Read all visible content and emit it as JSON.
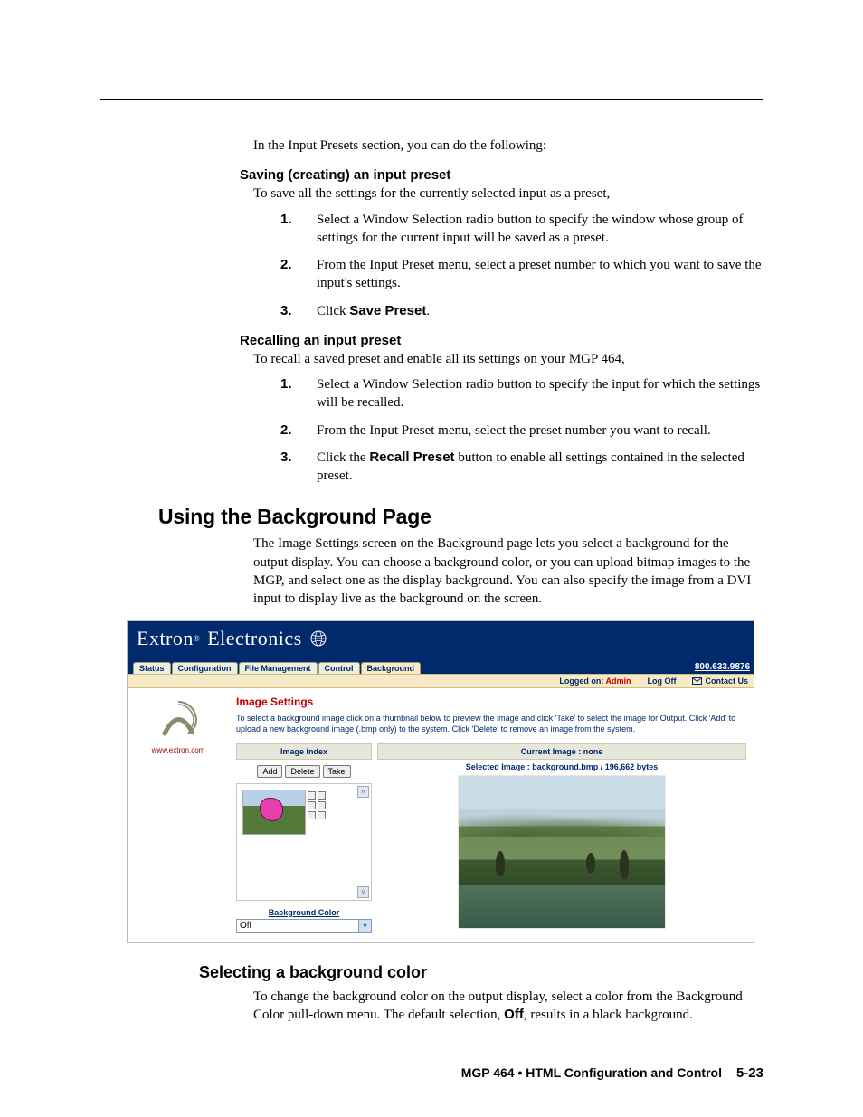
{
  "intro": "In the Input Presets section, you can do the following:",
  "saving": {
    "heading": "Saving (creating) an input preset",
    "lead": "To save all the settings for the currently selected input as a preset,",
    "n1": "1",
    "t1": "Select a Window Selection radio button to specify the window whose group of settings for the current input will be saved as a preset.",
    "n2": "2",
    "t2": "From the Input Preset menu, select a preset number to which you want to save the input's settings.",
    "n3": "3",
    "t3a": "Click ",
    "t3b": "Save Preset",
    "t3c": "."
  },
  "recalling": {
    "heading": "Recalling an input preset",
    "lead": "To recall a saved preset and enable all its settings on your MGP 464,",
    "n1": "1",
    "t1": "Select a Window Selection radio button to specify the input for which the settings will be recalled.",
    "n2": "2",
    "t2": "From the Input Preset menu, select the preset number you want to recall.",
    "n3": "3",
    "t3a": "Click the ",
    "t3b": "Recall Preset",
    "t3c": " button to enable all settings contained in the selected preset."
  },
  "bgpage": {
    "heading": "Using the Background Page",
    "para": "The Image Settings screen on the Background page lets you select a background for the output display.  You can choose a background color, or you can upload bitmap images to the MGP, and select one as the display background.  You can also specify the image from a DVI input to display live as the background on the screen."
  },
  "shot": {
    "brand_a": "Extron",
    "brand_b": "Electronics",
    "tabs": {
      "status": "Status",
      "config": "Configuration",
      "file": "File Management",
      "control": "Control",
      "bg": "Background"
    },
    "phone": "800.633.9876",
    "logged_label": "Logged on: ",
    "logged_user": "Admin",
    "logoff": "Log Off",
    "contact": "Contact Us",
    "site": "www.extron.com",
    "title": "Image Settings",
    "desc": "To select a background image click on a thumbnail below to preview the image and click 'Take' to select the image for Output. Click 'Add' to upload a new background image (.bmp only) to the system. Click 'Delete' to remove an image from the system.",
    "image_index": "Image Index",
    "add": "Add",
    "delete": "Delete",
    "take": "Take",
    "bgcolor_label": "Background Color",
    "bgcolor_value": "Off",
    "current": "Current Image : none",
    "selected": "Selected Image : background.bmp / 196,662 bytes"
  },
  "selectbg": {
    "heading": "Selecting a background color",
    "para_a": "To change the background color on the output display, select a color from the Background Color pull-down menu.  The default selection, ",
    "para_b": "Off",
    "para_c": ", results in a black background."
  },
  "footer": {
    "doc": "MGP 464 • HTML Configuration and Control",
    "page": "5-23"
  }
}
